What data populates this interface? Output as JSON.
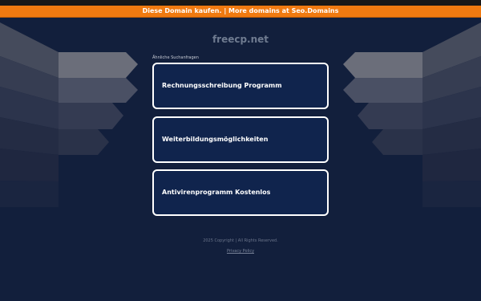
{
  "banner": {
    "text": "Diese Domain kaufen. | More domains at Seo.Domains"
  },
  "site": {
    "title": "freecp.net"
  },
  "related": {
    "label": "Ähnliche Suchanfragen",
    "items": [
      {
        "label": "Rechnungsschreibung Programm"
      },
      {
        "label": "Weiterbildungsmöglichkeiten"
      },
      {
        "label": "Antivirenprogramm Kostenlos"
      }
    ]
  },
  "footer": {
    "copyright": "2025 Copyright | All Rights Reserved.",
    "privacy": "Privacy Policy"
  },
  "colors": {
    "background": "#121f3c",
    "banner": "#f07a10",
    "card": "#10244d",
    "card_border": "#ffffff"
  }
}
